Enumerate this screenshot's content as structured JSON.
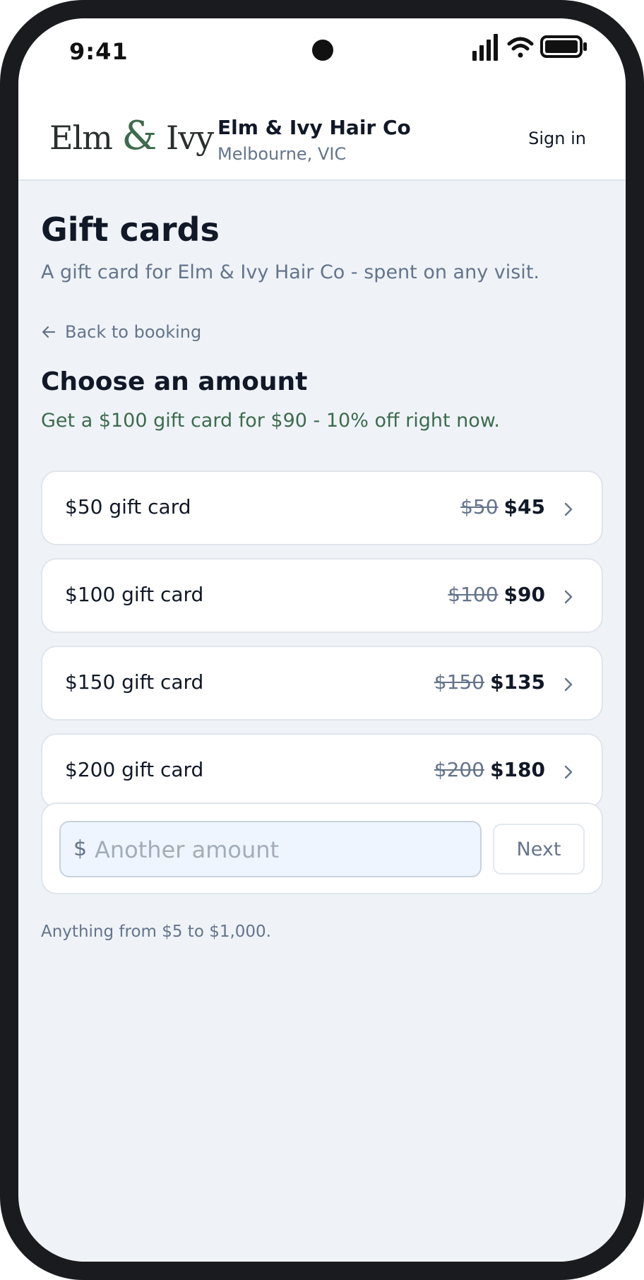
{
  "status_bar": {
    "time": "9:41"
  },
  "header": {
    "logo_left": "Elm ",
    "logo_amp": "&",
    "logo_right": " Ivy",
    "salon_name": "Elm & Ivy Hair Co",
    "location": "Melbourne, VIC",
    "sign_in": "Sign in"
  },
  "page": {
    "title": "Gift cards",
    "subtitle": "A gift card for Elm & Ivy Hair Co - spent on any visit.",
    "back_link": "Back to booking",
    "section_title": "Choose an amount",
    "promo": "Get a $100 gift card for $90 - 10% off right now."
  },
  "options": [
    {
      "label": "$50 gift card",
      "old_price": "$50",
      "new_price": "$45"
    },
    {
      "label": "$100 gift card",
      "old_price": "$100",
      "new_price": "$90"
    },
    {
      "label": "$150 gift card",
      "old_price": "$150",
      "new_price": "$135"
    },
    {
      "label": "$200 gift card",
      "old_price": "$200",
      "new_price": "$180"
    }
  ],
  "custom_amount": {
    "currency": "$",
    "placeholder": "Another amount",
    "next_label": "Next",
    "helper": "Anything from $5 to $1,000."
  },
  "colors": {
    "accent_green": "#3d6b4d",
    "text_dark": "#111827",
    "text_muted": "#64748b",
    "background": "#eff3f8"
  },
  "icons": [
    "signal-icon",
    "wifi-icon",
    "battery-icon",
    "arrow-left-icon",
    "chevron-right-icon"
  ]
}
